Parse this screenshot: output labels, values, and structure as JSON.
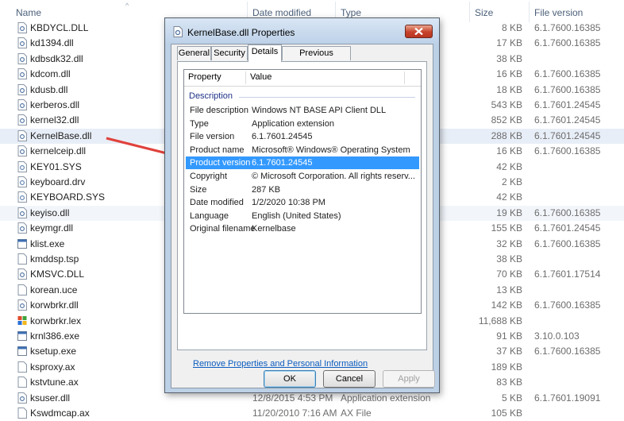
{
  "columns": {
    "name": "Name",
    "date": "Date modified",
    "type": "Type",
    "size": "Size",
    "version": "File version"
  },
  "files": [
    {
      "name": "KBDYCL.DLL",
      "date": "",
      "type": "",
      "size": "8 KB",
      "version": "6.1.7600.16385",
      "icon": "dll-icon"
    },
    {
      "name": "kd1394.dll",
      "date": "",
      "type": "",
      "size": "17 KB",
      "version": "6.1.7600.16385",
      "icon": "dll-icon"
    },
    {
      "name": "kdbsdk32.dll",
      "date": "",
      "type": "",
      "size": "38 KB",
      "version": "",
      "icon": "dll-icon"
    },
    {
      "name": "kdcom.dll",
      "date": "",
      "type": "",
      "size": "16 KB",
      "version": "6.1.7600.16385",
      "icon": "dll-icon"
    },
    {
      "name": "kdusb.dll",
      "date": "",
      "type": "",
      "size": "18 KB",
      "version": "6.1.7600.16385",
      "icon": "dll-icon"
    },
    {
      "name": "kerberos.dll",
      "date": "",
      "type": "",
      "size": "543 KB",
      "version": "6.1.7601.24545",
      "icon": "dll-icon"
    },
    {
      "name": "kernel32.dll",
      "date": "",
      "type": "",
      "size": "852 KB",
      "version": "6.1.7601.24545",
      "icon": "dll-icon"
    },
    {
      "name": "KernelBase.dll",
      "date": "",
      "type": "",
      "size": "288 KB",
      "version": "6.1.7601.24545",
      "icon": "dll-icon"
    },
    {
      "name": "kernelceip.dll",
      "date": "",
      "type": "",
      "size": "16 KB",
      "version": "6.1.7600.16385",
      "icon": "dll-icon"
    },
    {
      "name": "KEY01.SYS",
      "date": "",
      "type": "",
      "size": "42 KB",
      "version": "",
      "icon": "sys-icon"
    },
    {
      "name": "keyboard.drv",
      "date": "",
      "type": "",
      "size": "2 KB",
      "version": "",
      "icon": "drv-icon"
    },
    {
      "name": "KEYBOARD.SYS",
      "date": "",
      "type": "",
      "size": "42 KB",
      "version": "",
      "icon": "sys-icon"
    },
    {
      "name": "keyiso.dll",
      "date": "",
      "type": "",
      "size": "19 KB",
      "version": "6.1.7600.16385",
      "icon": "dll-icon"
    },
    {
      "name": "keymgr.dll",
      "date": "",
      "type": "",
      "size": "155 KB",
      "version": "6.1.7601.24545",
      "icon": "dll-icon"
    },
    {
      "name": "klist.exe",
      "date": "",
      "type": "",
      "size": "32 KB",
      "version": "6.1.7600.16385",
      "icon": "exe-icon"
    },
    {
      "name": "kmddsp.tsp",
      "date": "",
      "type": "",
      "size": "38 KB",
      "version": "",
      "icon": "file-icon"
    },
    {
      "name": "KMSVC.DLL",
      "date": "",
      "type": "",
      "size": "70 KB",
      "version": "6.1.7601.17514",
      "icon": "dll-icon"
    },
    {
      "name": "korean.uce",
      "date": "",
      "type": "",
      "size": "13 KB",
      "version": "",
      "icon": "file-icon"
    },
    {
      "name": "korwbrkr.dll",
      "date": "",
      "type": "",
      "size": "142 KB",
      "version": "6.1.7600.16385",
      "icon": "dll-icon"
    },
    {
      "name": "korwbrkr.lex",
      "date": "",
      "type": "",
      "size": "11,688 KB",
      "version": "",
      "icon": "lex-icon"
    },
    {
      "name": "krnl386.exe",
      "date": "",
      "type": "",
      "size": "91 KB",
      "version": "3.10.0.103",
      "icon": "exe-icon"
    },
    {
      "name": "ksetup.exe",
      "date": "",
      "type": "",
      "size": "37 KB",
      "version": "6.1.7600.16385",
      "icon": "exe-icon"
    },
    {
      "name": "ksproxy.ax",
      "date": "",
      "type": "",
      "size": "189 KB",
      "version": "",
      "icon": "file-icon"
    },
    {
      "name": "kstvtune.ax",
      "date": "",
      "type": "",
      "size": "83 KB",
      "version": "",
      "icon": "file-icon"
    },
    {
      "name": "ksuser.dll",
      "date": "12/8/2015 4:53 PM",
      "type": "Application extension",
      "size": "5 KB",
      "version": "6.1.7601.19091",
      "icon": "dll-icon"
    },
    {
      "name": "Kswdmcap.ax",
      "date": "11/20/2010 7:16 AM",
      "type": "AX File",
      "size": "105 KB",
      "version": "",
      "icon": "file-icon"
    }
  ],
  "dialog": {
    "title": "KernelBase.dll Properties",
    "tabs": [
      "General",
      "Security",
      "Details",
      "Previous Versions"
    ],
    "active_tab": "Details",
    "col_property": "Property",
    "col_value": "Value",
    "group": "Description",
    "properties": [
      {
        "name": "File description",
        "value": "Windows NT BASE API Client DLL"
      },
      {
        "name": "Type",
        "value": "Application extension"
      },
      {
        "name": "File version",
        "value": "6.1.7601.24545"
      },
      {
        "name": "Product name",
        "value": "Microsoft® Windows® Operating System"
      },
      {
        "name": "Product version",
        "value": "6.1.7601.24545"
      },
      {
        "name": "Copyright",
        "value": "© Microsoft Corporation. All rights reserv..."
      },
      {
        "name": "Size",
        "value": "287 KB"
      },
      {
        "name": "Date modified",
        "value": "1/2/2020 10:38 PM"
      },
      {
        "name": "Language",
        "value": "English (United States)"
      },
      {
        "name": "Original filename",
        "value": "Kernelbase"
      }
    ],
    "selected_property": "Product version",
    "remove_link": "Remove Properties and Personal Information",
    "ok": "OK",
    "cancel": "Cancel",
    "apply": "Apply"
  },
  "colors": {
    "selection": "#3399ff",
    "annotation_arrow": "#e0413b",
    "link": "#0b5cbf"
  }
}
